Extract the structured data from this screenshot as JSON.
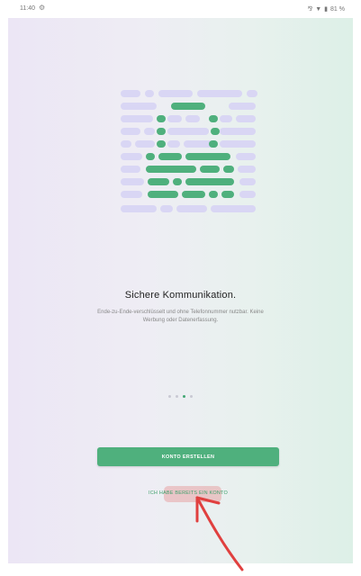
{
  "status_bar": {
    "time": "11:40",
    "battery": "81 %"
  },
  "onboarding": {
    "headline": "Sichere Kommunikation.",
    "body": "Ende-zu-Ende-verschlüsselt und ohne Telefonnummer nutzbar. Keine Werbung oder Datenerfassung.",
    "pager": {
      "total": 4,
      "active_index": 2
    },
    "primary_button": "KONTO ERSTELLEN",
    "secondary_link": "ICH HABE BEREITS EIN KONTO"
  },
  "colors": {
    "accent": "#4fb07d",
    "illustration_light": "#d9d6f4"
  },
  "icons": [
    "gear-icon",
    "signal-icon",
    "wifi-icon",
    "battery-icon",
    "padlock-illustration"
  ]
}
